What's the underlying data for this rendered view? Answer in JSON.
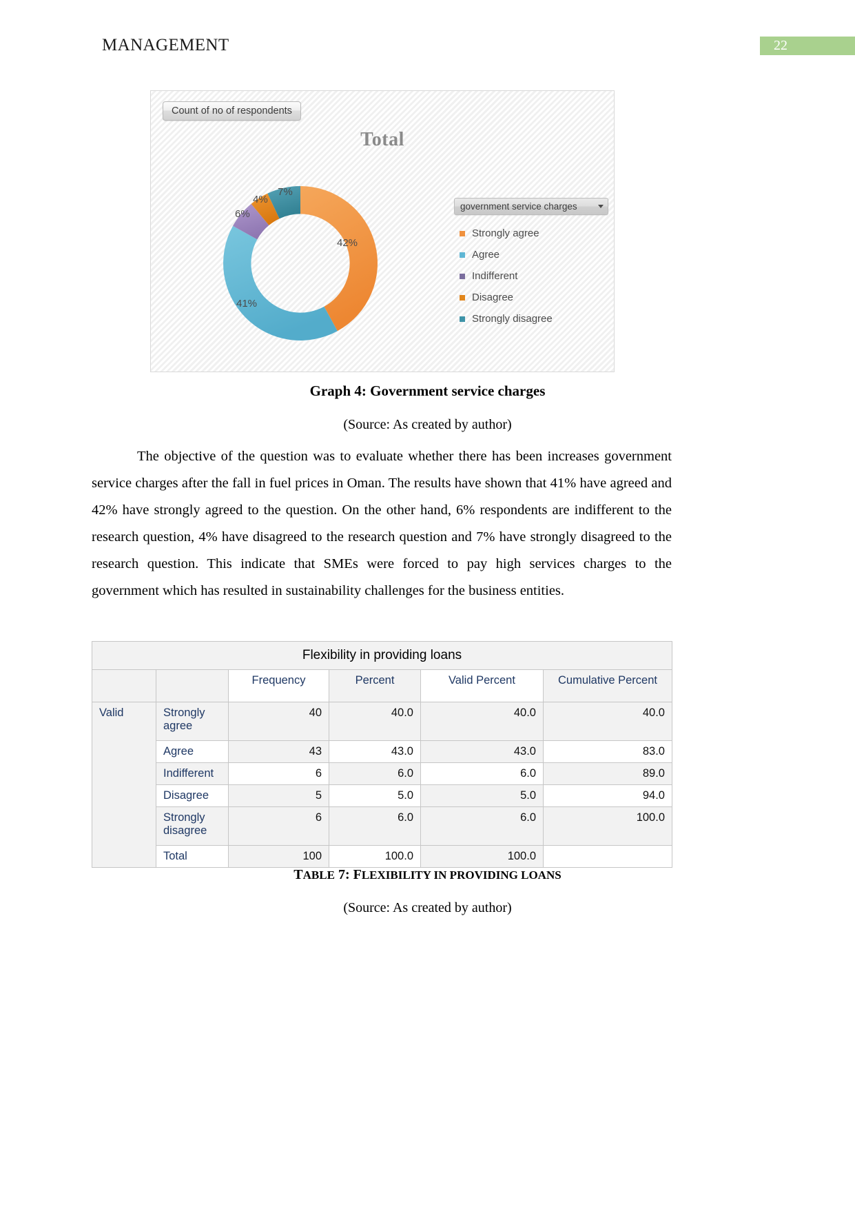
{
  "header": {
    "title": "MANAGEMENT",
    "page_number": "22",
    "accent_color": "#a9d18e"
  },
  "figure": {
    "field_button_label": "Count of no of respondents",
    "chart_title": "Total",
    "legend_header": "government service charges",
    "caret_icon": "chevron-down-icon",
    "caption": "Graph 4: Government service charges",
    "source": "(Source: As created by author)"
  },
  "chart_data": {
    "type": "pie",
    "variant": "doughnut",
    "title": "Total",
    "legend_title": "government service charges",
    "legend_position": "right",
    "categories": [
      "Strongly agree",
      "Agree",
      "Indifferent",
      "Disagree",
      "Strongly disagree"
    ],
    "values": [
      42,
      41,
      6,
      4,
      7
    ],
    "labels": [
      "42%",
      "41%",
      "6%",
      "4%",
      "7%"
    ],
    "colors": [
      "#F0913E",
      "#5FB6D4",
      "#9D85BE",
      "#E1861C",
      "#3E93A8"
    ],
    "unit": "percent",
    "value_label_format": "percentage"
  },
  "body": {
    "paragraph": "The objective of the question was to evaluate whether there has been increases government service charges after the fall in fuel prices in Oman. The results have shown that 41% have agreed and 42% have strongly agreed to the question. On the other hand, 6% respondents are indifferent to the research question, 4% have disagreed to the research question and 7% have strongly disagreed to the research question. This indicate that SMEs were forced to pay high services charges to the government which has resulted in sustainability challenges for the business entities."
  },
  "table": {
    "title": "Flexibility in providing loans",
    "columns": [
      "",
      "",
      "Frequency",
      "Percent",
      "Valid Percent",
      "Cumulative Percent"
    ],
    "group_label": "Valid",
    "rows": [
      {
        "label": "Strongly agree",
        "frequency": "40",
        "percent": "40.0",
        "valid_percent": "40.0",
        "cumulative_percent": "40.0"
      },
      {
        "label": "Agree",
        "frequency": "43",
        "percent": "43.0",
        "valid_percent": "43.0",
        "cumulative_percent": "83.0"
      },
      {
        "label": "Indifferent",
        "frequency": "6",
        "percent": "6.0",
        "valid_percent": "6.0",
        "cumulative_percent": "89.0"
      },
      {
        "label": "Disagree",
        "frequency": "5",
        "percent": "5.0",
        "valid_percent": "5.0",
        "cumulative_percent": "94.0"
      },
      {
        "label": "Strongly disagree",
        "frequency": "6",
        "percent": "6.0",
        "valid_percent": "6.0",
        "cumulative_percent": "100.0"
      },
      {
        "label": "Total",
        "frequency": "100",
        "percent": "100.0",
        "valid_percent": "100.0",
        "cumulative_percent": ""
      }
    ],
    "caption_prefix": "T",
    "caption_rest_1": "ABLE",
    "caption_num": " 7: F",
    "caption_rest_2": "LEXIBILITY IN PROVIDING LOANS",
    "caption_plain": "TABLE 7: FLEXIBILITY IN PROVIDING LOANS",
    "source": "(Source: As created by author)"
  }
}
